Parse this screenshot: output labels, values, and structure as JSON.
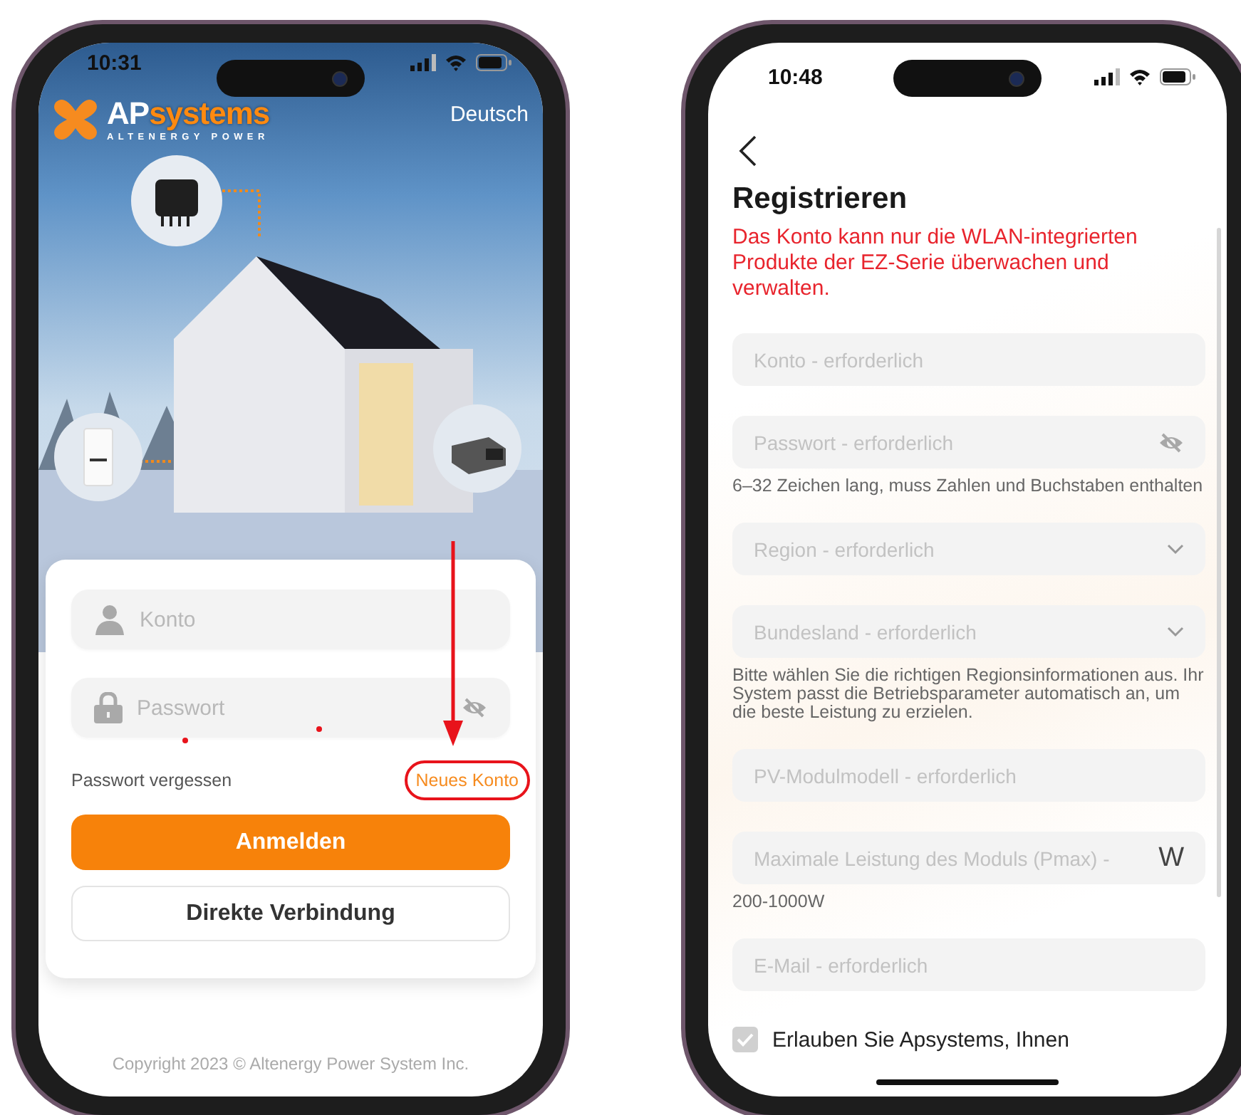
{
  "login_screen": {
    "status_bar": {
      "time": "10:31"
    },
    "logo": {
      "brand_prefix": "AP",
      "brand_suffix": "systems",
      "tagline": "ALTENERGY POWER"
    },
    "language": "Deutsch",
    "fields": [
      {
        "kind": "account",
        "placeholder": "Konto"
      },
      {
        "kind": "password",
        "placeholder": "Passwort"
      }
    ],
    "forgot_password": "Passwort vergessen",
    "new_account": {
      "label": "Neues Konto",
      "highlighted": true
    },
    "buttons": [
      {
        "kind": "primary",
        "label": "Anmelden"
      },
      {
        "kind": "secondary",
        "label": "Direkte Verbindung"
      }
    ],
    "copyright": "Copyright 2023 © Altenergy Power System Inc."
  },
  "register_screen": {
    "status_bar": {
      "time": "10:48"
    },
    "title": "Registrieren",
    "notice": "Das Konto kann nur die WLAN-integrierten Produkte der EZ-Serie überwachen und verwalten.",
    "fields": [
      {
        "kind": "text",
        "placeholder": "Konto - erforderlich"
      },
      {
        "kind": "password",
        "placeholder": "Passwort - erforderlich",
        "helper": "6–32 Zeichen lang, muss Zahlen und Buchstaben enthalten"
      },
      {
        "kind": "select",
        "placeholder": "Region - erforderlich"
      },
      {
        "kind": "select",
        "placeholder": "Bundesland - erforderlich",
        "helper": "Bitte wählen Sie die richtigen Regionsinformationen aus. Ihr System passt die Betriebsparameter automatisch an, um die beste Leistung zu erzielen."
      },
      {
        "kind": "text",
        "placeholder": "PV-Modulmodell - erforderlich"
      },
      {
        "kind": "unit",
        "placeholder": "Maximale Leistung des Moduls (Pmax) -",
        "unit": "W",
        "helper": "200-1000W"
      },
      {
        "kind": "text",
        "placeholder": "E-Mail - erforderlich"
      }
    ],
    "consent": {
      "label": "Erlauben Sie Apsystems, Ihnen",
      "checked": true
    }
  }
}
